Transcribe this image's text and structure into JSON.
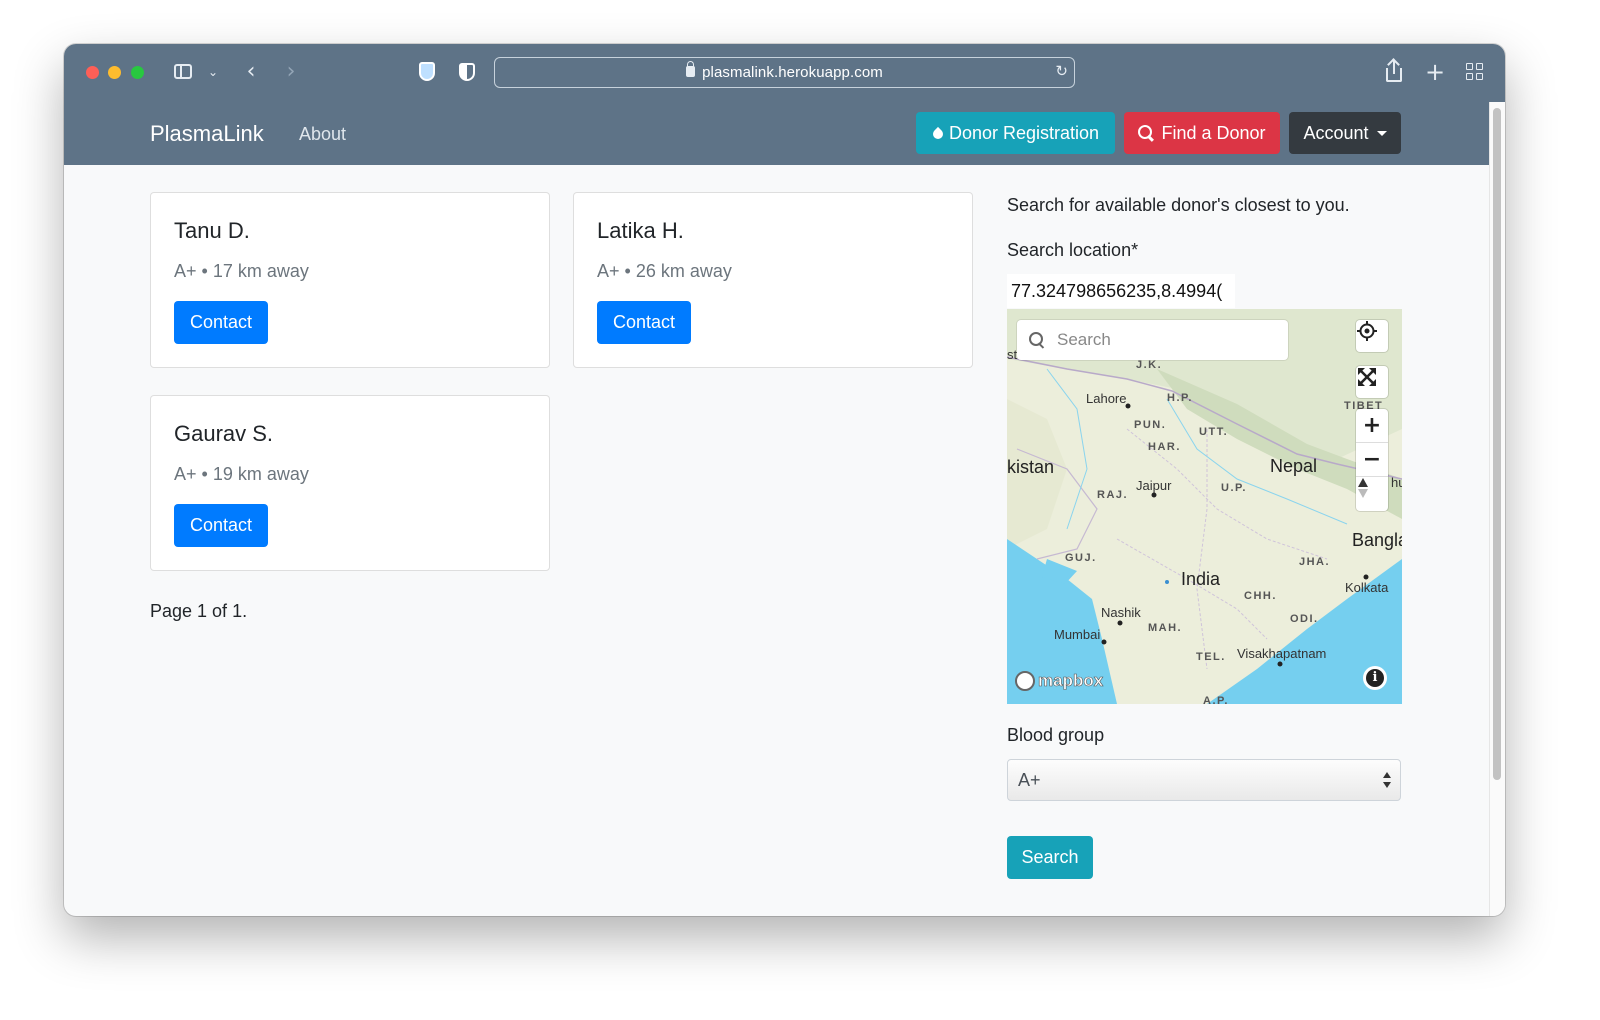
{
  "browser": {
    "url": "plasmalink.herokuapp.com"
  },
  "navbar": {
    "brand": "PlasmaLink",
    "about": "About",
    "donor_registration": "Donor Registration",
    "find_donor": "Find a Donor",
    "account": "Account"
  },
  "donors": [
    {
      "name": "Tanu D.",
      "meta": "A+ • 17 km away",
      "contact": "Contact"
    },
    {
      "name": "Latika H.",
      "meta": "A+ • 26 km away",
      "contact": "Contact"
    },
    {
      "name": "Gaurav S.",
      "meta": "A+ • 19 km away",
      "contact": "Contact"
    }
  ],
  "pagination": "Page 1 of 1.",
  "sidebar": {
    "intro": "Search for available donor's closest to you.",
    "location_label": "Search location*",
    "location_value": "77.324798656235,8.4994(",
    "map": {
      "search_placeholder": "Search",
      "attribution": "mapbox",
      "info": "i",
      "labels": {
        "jk": "J.K.",
        "hp": "H.P.",
        "lahore": "Lahore",
        "tibet": "TIBET",
        "pun": "PUN.",
        "utt": "UTT.",
        "har": "HAR.",
        "pakistan": "kistan",
        "nepal": "Nepal",
        "raj": "RAJ.",
        "jaipur": "Jaipur",
        "up": "U.P.",
        "bangla": "Bangla",
        "guj": "GUJ.",
        "jha": "JHA.",
        "india": "India",
        "kolkata": "Kolkata",
        "chh": "CHH.",
        "nashik": "Nashik",
        "odi": "ODI.",
        "mumbai": "Mumbai",
        "mah": "MAH.",
        "tel": "TEL.",
        "visakhapatnam": "Visakhapatnam",
        "bhu": "hu",
        "st": "st",
        "ap": "A.P."
      }
    },
    "blood_group_label": "Blood group",
    "blood_group_value": "A+",
    "search_button": "Search"
  }
}
